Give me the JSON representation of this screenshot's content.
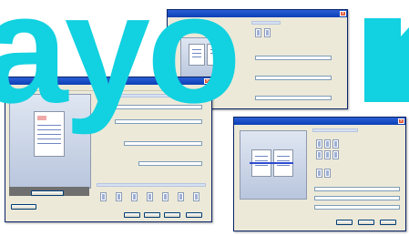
{
  "watermark": {
    "text": "ayo",
    "color": "#12d1e0"
  },
  "win_back": {
    "title": "",
    "tabs": [
      "",
      ""
    ],
    "fields": [
      "",
      "",
      ""
    ]
  },
  "win_main": {
    "title": "",
    "menu": [
      "",
      "",
      "",
      "",
      "",
      "",
      ""
    ],
    "labels": [
      "",
      "",
      "",
      ""
    ],
    "fields": [
      "",
      "",
      "",
      ""
    ],
    "preview_button": "",
    "ok": "",
    "cancel": "",
    "apply": "",
    "help": ""
  },
  "win_right": {
    "title": "",
    "labels": [
      "",
      "",
      ""
    ],
    "fields": [
      "",
      "",
      ""
    ],
    "ok": "",
    "cancel": "",
    "help": ""
  },
  "colors": {
    "titlebar": "#0b3fb5",
    "dialog_bg": "#ece9d8",
    "accent": "#2e4bd2"
  },
  "icons": [
    "close-icon",
    "page-preview-icon",
    "arrow-icon",
    "layout-icon"
  ]
}
